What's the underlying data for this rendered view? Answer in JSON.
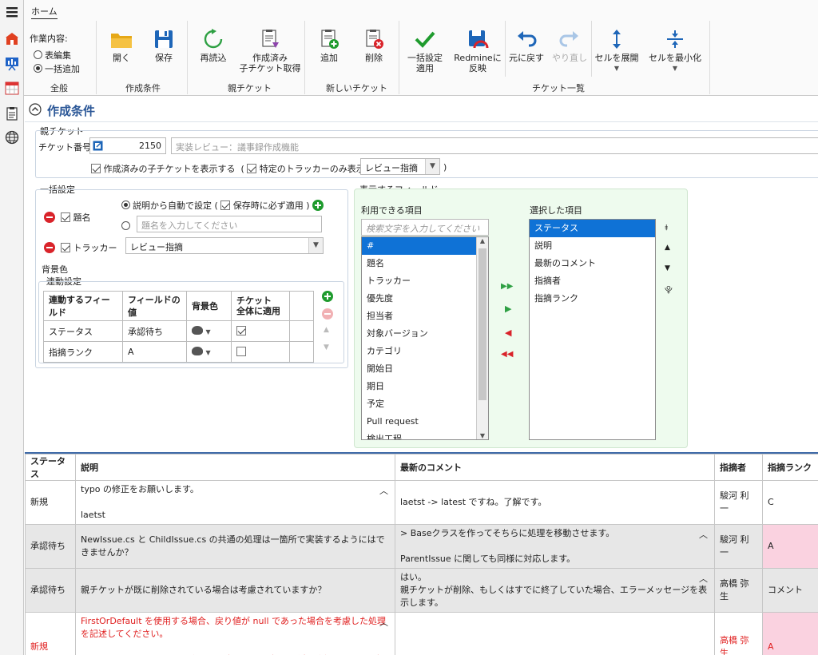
{
  "ribbon": {
    "tab": "ホーム",
    "mode_label": "作業内容:",
    "mode_option_edit": "表編集",
    "mode_option_bulk": "一括追加",
    "btn_open": "開く",
    "btn_save": "保存",
    "btn_reload": "再読込",
    "btn_get_children": "作成済み\n子チケット取得",
    "btn_add": "追加",
    "btn_delete": "削除",
    "btn_bulk_apply": "一括設定\n適用",
    "btn_redmine": "Redmineに\n反映",
    "btn_undo": "元に戻す",
    "btn_redo": "やり直し",
    "btn_expand": "セルを展開",
    "btn_minimize": "セルを最小化",
    "grp_general": "全般",
    "grp_conditions": "作成条件",
    "grp_parent": "親チケット",
    "grp_new": "新しいチケット",
    "grp_list": "チケット一覧",
    "accent": "#2b5797"
  },
  "panel": {
    "title": "作成条件",
    "parent": {
      "legend": "親チケット",
      "ticket_no_label": "チケット番号",
      "ticket_no": "2150",
      "ticket_title": "実装レビュー：議事録作成機能",
      "show_created_label": "作成済みの子チケットを表示する",
      "tracker_only_label": "特定のトラッカーのみ表示:",
      "tracker_value": "レビュー指摘",
      "paren_open": "(",
      "paren_close": ")"
    },
    "bulk": {
      "legend": "一括設定",
      "subject_label": "題名",
      "auto_label": "説明から自動で設定",
      "save_apply_label": "保存時に必ず適用",
      "subject_placeholder": "題名を入力してください",
      "tracker_label": "トラッカー",
      "tracker_value": "レビュー指摘",
      "bg_legend": "背景色",
      "linked_legend": "連動設定",
      "col_field": "連動するフィールド",
      "col_value": "フィールドの値",
      "col_bg": "背景色",
      "col_whole": "チケット\n全体に適用",
      "rows": [
        {
          "field": "ステータス",
          "value": "承認待ち",
          "whole": true
        },
        {
          "field": "指摘ランク",
          "value": "A",
          "whole": false
        }
      ]
    },
    "fields": {
      "legend": "表示するフィールド",
      "available_label": "利用できる項目",
      "search_placeholder": "検索文字を入力してください",
      "available": [
        "#",
        "題名",
        "トラッカー",
        "優先度",
        "担当者",
        "対象バージョン",
        "カテゴリ",
        "開始日",
        "期日",
        "予定",
        "Pull request",
        "検出工程"
      ],
      "selected_label": "選択した項目",
      "selected": [
        "ステータス",
        "説明",
        "最新のコメント",
        "指摘者",
        "指摘ランク"
      ]
    }
  },
  "grid": {
    "headers": [
      "ステータス",
      "説明",
      "最新のコメント",
      "指摘者",
      "指摘ランク"
    ],
    "rows": [
      {
        "status": "新規",
        "desc": "typo の修正をお願いします。\n\nlaetst",
        "comment": "laetst -> latest ですね。了解です。",
        "reporter": "駿河 利一",
        "rank": "C"
      },
      {
        "status": "承認待ち",
        "desc": "NewIssue.cs と ChildIssue.cs の共通の処理は一箇所で実装するようにはできませんか？",
        "comment": "> Baseクラスを作ってそちらに処理を移動させます。\n\nParentIssue に関しても同様に対応します。",
        "reporter": "駿河 利一",
        "rank": "A"
      },
      {
        "status": "承認待ち",
        "desc": "親チケットが既に削除されている場合は考慮されていますか？",
        "comment": "はい。\n親チケットが削除、もしくはすでに終了していた場合、エラーメッセージを表示します。",
        "reporter": "高橋 弥生",
        "rank": "コメント"
      },
      {
        "status": "新規",
        "desc": "FirstOrDefault を使用する場合、戻り値が null であった場合を考慮した処理を記述してください。\n\ngetIssueAsync も null を返すパスがありますが、呼び出し側でそのことが考慮されていません。",
        "comment": "",
        "reporter": "高橋 弥生",
        "rank": "A"
      }
    ]
  }
}
